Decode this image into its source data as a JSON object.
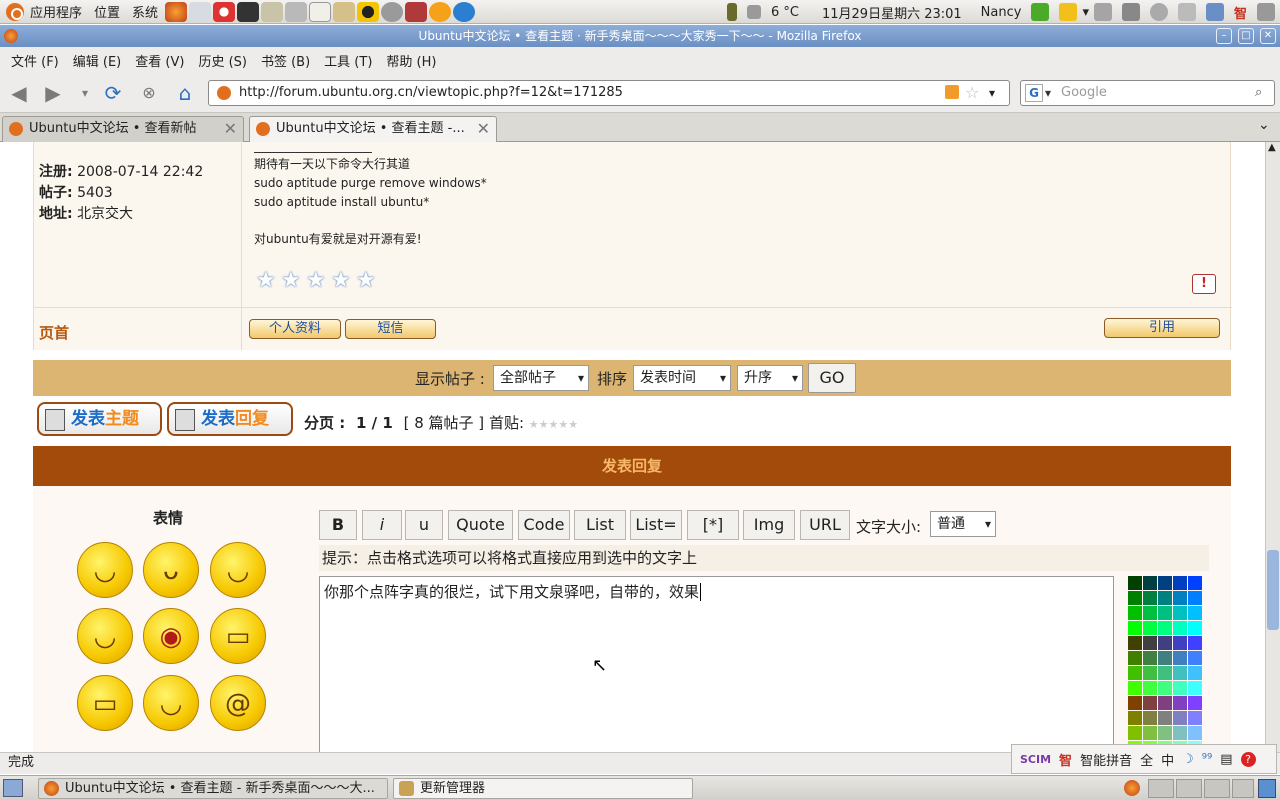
{
  "panel": {
    "apps": "应用程序",
    "places": "位置",
    "system": "系统",
    "weather": "6 °C",
    "clock": "11月29日星期六 23:01",
    "user": "Nancy",
    "ime_short": "智"
  },
  "window": {
    "title": "Ubuntu中文论坛 • 查看主题 · 新手秀桌面～～～大家秀一下～～ - Mozilla Firefox"
  },
  "menu": [
    "文件 (F)",
    "编辑 (E)",
    "查看 (V)",
    "历史 (S)",
    "书签 (B)",
    "工具 (T)",
    "帮助 (H)"
  ],
  "nav": {
    "url": "http://forum.ubuntu.org.cn/viewtopic.php?f=12&t=171285",
    "search_placeholder": "Google"
  },
  "tabs": [
    {
      "label": "Ubuntu中文论坛 • 查看新帖"
    },
    {
      "label": "Ubuntu中文论坛 • 查看主题 -..."
    }
  ],
  "profile": {
    "reg_label": "注册:",
    "reg_value": "2008-07-14 22:42",
    "posts_label": "帖子:",
    "posts_value": "5403",
    "loc_label": "地址:",
    "loc_value": "北京交大"
  },
  "signature": [
    "期待有一天以下命令大行其道",
    "sudo aptitude purge remove windows*",
    "sudo aptitude install ubuntu*",
    "对ubuntu有爱就是对开源有爱!"
  ],
  "post_actions": {
    "top_link": "页首",
    "profile_btn": "个人资料",
    "pm_btn": "短信",
    "quote_btn": "引用",
    "report": "!"
  },
  "rating": {
    "max": 5,
    "value": 0
  },
  "filter": {
    "show_label": "显示帖子 :",
    "show_value": "全部帖子",
    "sort_label": "排序",
    "sort_value": "发表时间",
    "order_value": "升序",
    "go": "GO"
  },
  "topic_buttons": {
    "new_topic_a": "发表",
    "new_topic_b": "主题",
    "reply_a": "发表",
    "reply_b": "回复"
  },
  "pagination": {
    "label": "分页 :",
    "value": "1 / 1",
    "count": "[ 8 篇帖子 ]",
    "first_post": "首贴:"
  },
  "reply": {
    "header": "发表回复",
    "smilies_label": "表情",
    "hint": "提示：点击格式选项可以将格式直接应用到选中的文字上",
    "message": "你那个点阵字真的很烂，试下用文泉驿吧，自带的，效果",
    "font_size_label": "文字大小:",
    "font_size_value": "普通"
  },
  "format_buttons": [
    "B",
    "i",
    "u",
    "Quote",
    "Code",
    "List",
    "List=",
    "[*]",
    "Img",
    "URL"
  ],
  "status": {
    "text": "完成"
  },
  "ime": {
    "label": "智能拼音",
    "full": "全",
    "lang": "中"
  },
  "taskbar": [
    {
      "label": "Ubuntu中文论坛 • 查看主题 - 新手秀桌面～～～大..."
    },
    {
      "label": "更新管理器"
    }
  ]
}
